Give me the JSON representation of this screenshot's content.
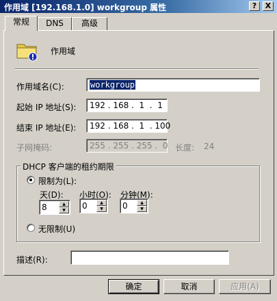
{
  "window": {
    "title": "作用域 [192.168.1.0] workgroup 属性",
    "help_button": "?",
    "close_button": "X"
  },
  "tabs": [
    {
      "label": "常规",
      "active": true
    },
    {
      "label": "DNS",
      "active": false
    },
    {
      "label": "高级",
      "active": false
    }
  ],
  "header": {
    "icon": "folder-dhcp-icon",
    "title": "作用域"
  },
  "fields": {
    "scope_name_label": "作用域名(C):",
    "scope_name_value": "workgroup",
    "start_ip_label": "起始 IP 地址(S):",
    "start_ip_value": "192 . 168 .  1  .  1",
    "end_ip_label": "结束 IP 地址(E):",
    "end_ip_value": "192 . 168 .  1  . 100",
    "subnet_label": "子网掩码:",
    "subnet_value": "255 . 255 . 255 .  0",
    "length_label": "长度:",
    "length_value": "24"
  },
  "lease": {
    "group_title": "DHCP 客户端的租约期限",
    "limited_label": "限制为(L):",
    "limited_selected": true,
    "days_label": "天(D):",
    "days_value": "8",
    "hours_label": "小时(O):",
    "hours_value": "0",
    "minutes_label": "分钟(M):",
    "minutes_value": "0",
    "unlimited_label": "无限制(U)",
    "unlimited_selected": false
  },
  "description": {
    "label": "描述(R):",
    "value": ""
  },
  "buttons": {
    "ok": "确定",
    "cancel": "取消",
    "apply": "应用(A)"
  }
}
